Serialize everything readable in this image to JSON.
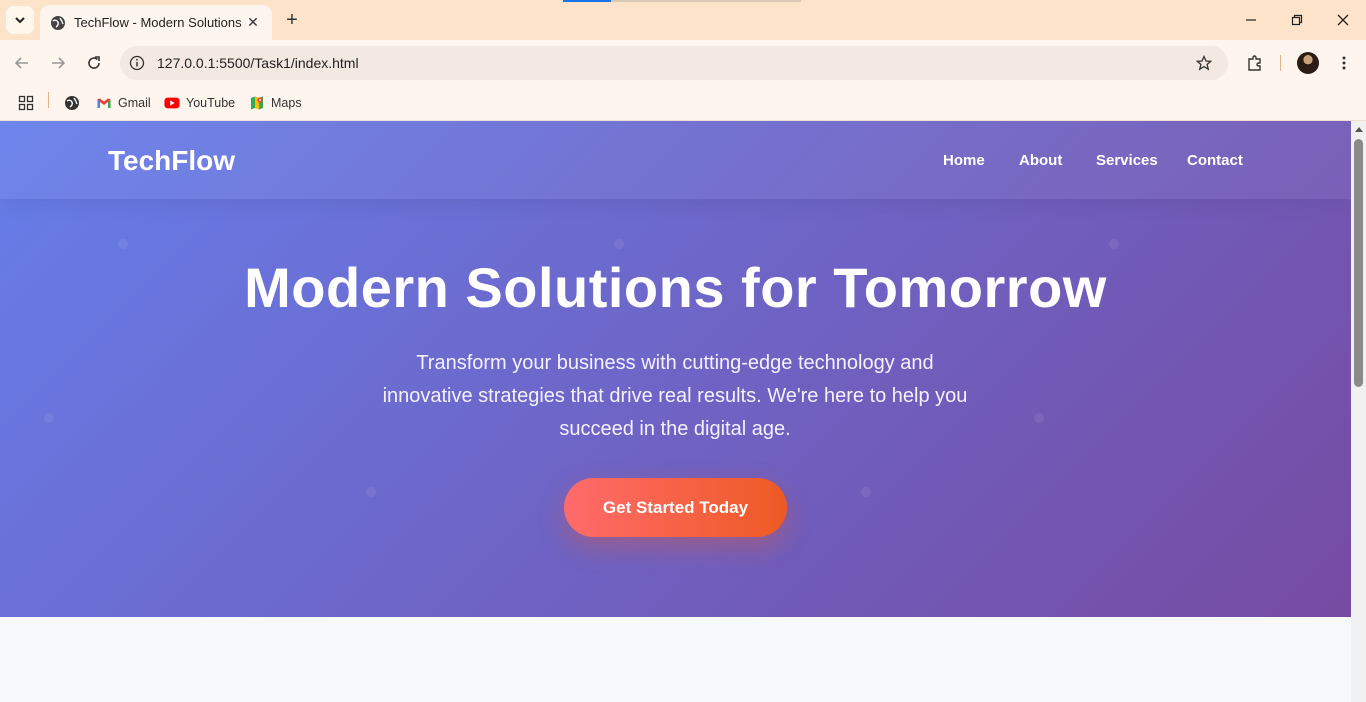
{
  "browser": {
    "tab": {
      "title": "TechFlow - Modern Solutions",
      "favicon": "globe-icon"
    },
    "address_bar": {
      "url": "127.0.0.1:5500/Task1/index.html"
    },
    "bookmarks": [
      {
        "label": "",
        "icon": "globe-icon"
      },
      {
        "label": "Gmail",
        "icon": "gmail-icon"
      },
      {
        "label": "YouTube",
        "icon": "youtube-icon"
      },
      {
        "label": "Maps",
        "icon": "maps-icon"
      }
    ],
    "colors": {
      "tabstrip": "#fde3c9",
      "toolbar": "#fff5ef",
      "omnibox": "#f3e8e2"
    }
  },
  "page": {
    "header": {
      "logo": "TechFlow",
      "nav": [
        "Home",
        "About",
        "Services",
        "Contact"
      ]
    },
    "hero": {
      "title": "Modern Solutions for Tomorrow",
      "subtitle": "Transform your business with cutting-edge technology and innovative strategies that drive real results. We're here to help you succeed in the digital age.",
      "cta": "Get Started Today"
    },
    "colors": {
      "gradient_start": "#667eea",
      "gradient_end": "#764ba2",
      "cta_start": "#ff6b6b",
      "cta_end": "#ee5a24",
      "below_fold": "#f8f9fa"
    }
  }
}
